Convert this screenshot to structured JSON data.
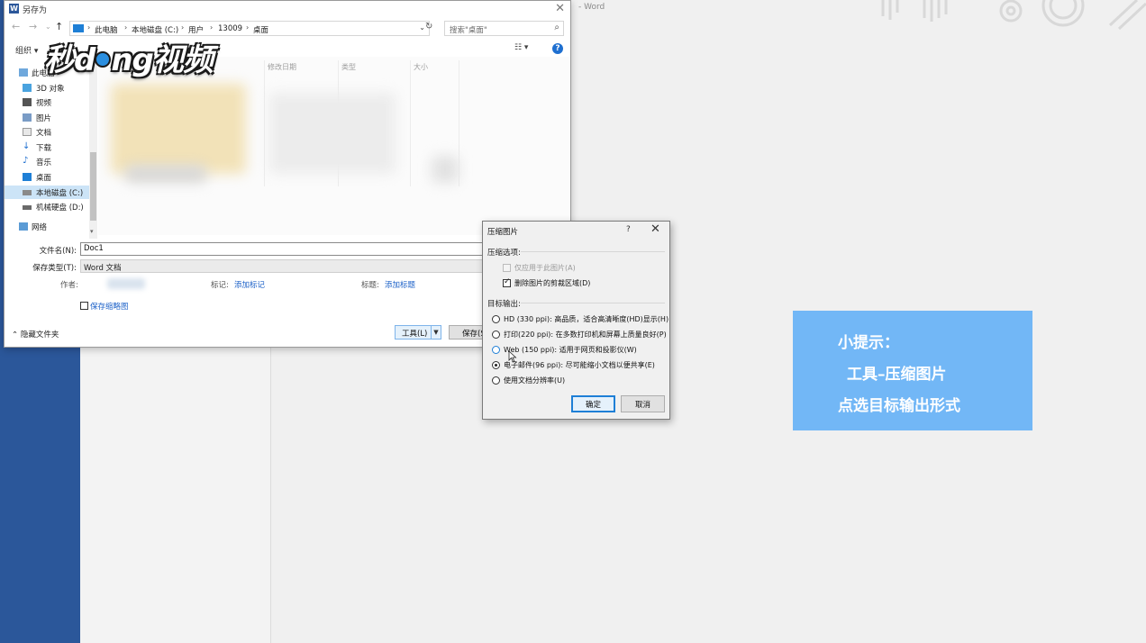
{
  "word": {
    "title_fragment": "- Word"
  },
  "save_as": {
    "title": "另存为",
    "address_crumbs": [
      "此电脑",
      "本地磁盘 (C:)",
      "用户",
      "13009",
      "桌面"
    ],
    "search_placeholder": "搜索\"桌面\"",
    "organize_label": "组织 ▾",
    "help_glyph": "?",
    "nav_tree": [
      {
        "label": "此电脑",
        "icon": "computer-icon"
      },
      {
        "label": "3D 对象",
        "icon": "3d-objects-icon"
      },
      {
        "label": "视频",
        "icon": "video-icon"
      },
      {
        "label": "图片",
        "icon": "pictures-icon"
      },
      {
        "label": "文档",
        "icon": "documents-icon"
      },
      {
        "label": "下载",
        "icon": "download-icon"
      },
      {
        "label": "音乐",
        "icon": "music-icon"
      },
      {
        "label": "桌面",
        "icon": "desktop-icon"
      },
      {
        "label": "本地磁盘 (C:)",
        "icon": "local-disk-icon",
        "selected": true
      },
      {
        "label": "机械硬盘 (D:)",
        "icon": "hard-disk-icon"
      },
      {
        "label": "网络",
        "icon": "network-icon"
      }
    ],
    "columns": [
      "修改日期",
      "类型",
      "大小"
    ],
    "filename_label": "文件名(N):",
    "filename_value": "Doc1",
    "filetype_label": "保存类型(T):",
    "filetype_value": "Word 文档",
    "author_label": "作者:",
    "tags_label": "标记:",
    "tags_link": "添加标记",
    "title_label": "标题:",
    "title_link": "添加标题",
    "thumbnail_label": "保存缩略图",
    "hide_folders_label": "隐藏文件夹",
    "tools_label": "工具(L)",
    "save_label": "保存(S"
  },
  "watermark": {
    "text_before": "秒d",
    "text_after": "ng视频"
  },
  "compress": {
    "title": "压缩图片",
    "help_glyph": "?",
    "options_heading": "压缩选项:",
    "apply_only_label": "仅应用于此图片(A)",
    "apply_only_checked": false,
    "apply_only_disabled": true,
    "delete_cropped_label": "删除图片的剪裁区域(D)",
    "delete_cropped_checked": true,
    "output_heading": "目标输出:",
    "resolutions": [
      {
        "label": "HD (330 ppi): 高品质，适合高清晰度(HD)显示(H)",
        "selected": false
      },
      {
        "label": "打印(220 ppi): 在多数打印机和屏幕上质量良好(P)",
        "selected": false
      },
      {
        "label": "Web (150 ppi): 适用于网页和投影仪(W)",
        "selected": false,
        "hover": true
      },
      {
        "label": "电子邮件(96 ppi): 尽可能缩小文档以便共享(E)",
        "selected": true
      },
      {
        "label": "使用文档分辨率(U)",
        "selected": false
      }
    ],
    "ok_label": "确定",
    "cancel_label": "取消"
  },
  "tip": {
    "line1": "小提示：",
    "line2": "工具–压缩图片",
    "line3": "点选目标输出形式"
  },
  "colors": {
    "word_blue": "#2b579a",
    "tip_bg": "#72b7f6",
    "link_blue": "#1e62c8",
    "focus_blue": "#1e7fd6"
  }
}
